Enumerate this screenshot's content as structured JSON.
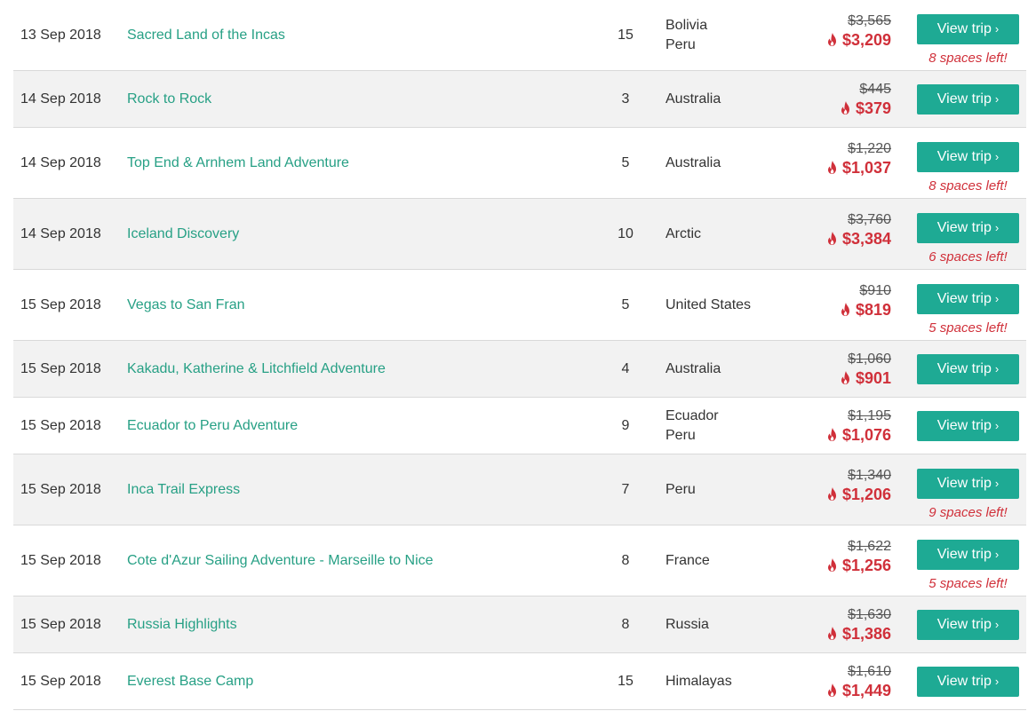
{
  "trips": [
    {
      "date": "13 Sep 2018",
      "name": "Sacred Land of the Incas",
      "days": "15",
      "destinations": [
        "Bolivia",
        "Peru"
      ],
      "old_price": "$3,565",
      "price": "$3,209",
      "button": "View trip",
      "spaces": "8 spaces left!",
      "alt": false
    },
    {
      "date": "14 Sep 2018",
      "name": "Rock to Rock",
      "days": "3",
      "destinations": [
        "Australia"
      ],
      "old_price": "$445",
      "price": "$379",
      "button": "View trip",
      "spaces": "",
      "alt": true
    },
    {
      "date": "14 Sep 2018",
      "name": "Top End & Arnhem Land Adventure",
      "days": "5",
      "destinations": [
        "Australia"
      ],
      "old_price": "$1,220",
      "price": "$1,037",
      "button": "View trip",
      "spaces": "8 spaces left!",
      "alt": false
    },
    {
      "date": "14 Sep 2018",
      "name": "Iceland Discovery",
      "days": "10",
      "destinations": [
        "Arctic"
      ],
      "old_price": "$3,760",
      "price": "$3,384",
      "button": "View trip",
      "spaces": "6 spaces left!",
      "alt": true
    },
    {
      "date": "15 Sep 2018",
      "name": "Vegas to San Fran",
      "days": "5",
      "destinations": [
        "United States"
      ],
      "old_price": "$910",
      "price": "$819",
      "button": "View trip",
      "spaces": "5 spaces left!",
      "alt": false
    },
    {
      "date": "15 Sep 2018",
      "name": "Kakadu, Katherine & Litchfield Adventure",
      "days": "4",
      "destinations": [
        "Australia"
      ],
      "old_price": "$1,060",
      "price": "$901",
      "button": "View trip",
      "spaces": "",
      "alt": true
    },
    {
      "date": "15 Sep 2018",
      "name": "Ecuador to Peru Adventure",
      "days": "9",
      "destinations": [
        "Ecuador",
        "Peru"
      ],
      "old_price": "$1,195",
      "price": "$1,076",
      "button": "View trip",
      "spaces": "",
      "alt": false
    },
    {
      "date": "15 Sep 2018",
      "name": "Inca Trail Express",
      "days": "7",
      "destinations": [
        "Peru"
      ],
      "old_price": "$1,340",
      "price": "$1,206",
      "button": "View trip",
      "spaces": "9 spaces left!",
      "alt": true
    },
    {
      "date": "15 Sep 2018",
      "name": "Cote d'Azur Sailing Adventure - Marseille to Nice",
      "days": "8",
      "destinations": [
        "France"
      ],
      "old_price": "$1,622",
      "price": "$1,256",
      "button": "View trip",
      "spaces": "5 spaces left!",
      "alt": false
    },
    {
      "date": "15 Sep 2018",
      "name": "Russia Highlights",
      "days": "8",
      "destinations": [
        "Russia"
      ],
      "old_price": "$1,630",
      "price": "$1,386",
      "button": "View trip",
      "spaces": "",
      "alt": true
    },
    {
      "date": "15 Sep 2018",
      "name": "Everest Base Camp",
      "days": "15",
      "destinations": [
        "Himalayas"
      ],
      "old_price": "$1,610",
      "price": "$1,449",
      "button": "View trip",
      "spaces": "",
      "alt": false
    }
  ],
  "colors": {
    "link": "#27a085",
    "button": "#1eaa94",
    "sale": "#d0303a",
    "row_alt": "#f2f2f2"
  },
  "icons": {
    "sale": "flame-icon",
    "button": "chevron-right-icon"
  }
}
